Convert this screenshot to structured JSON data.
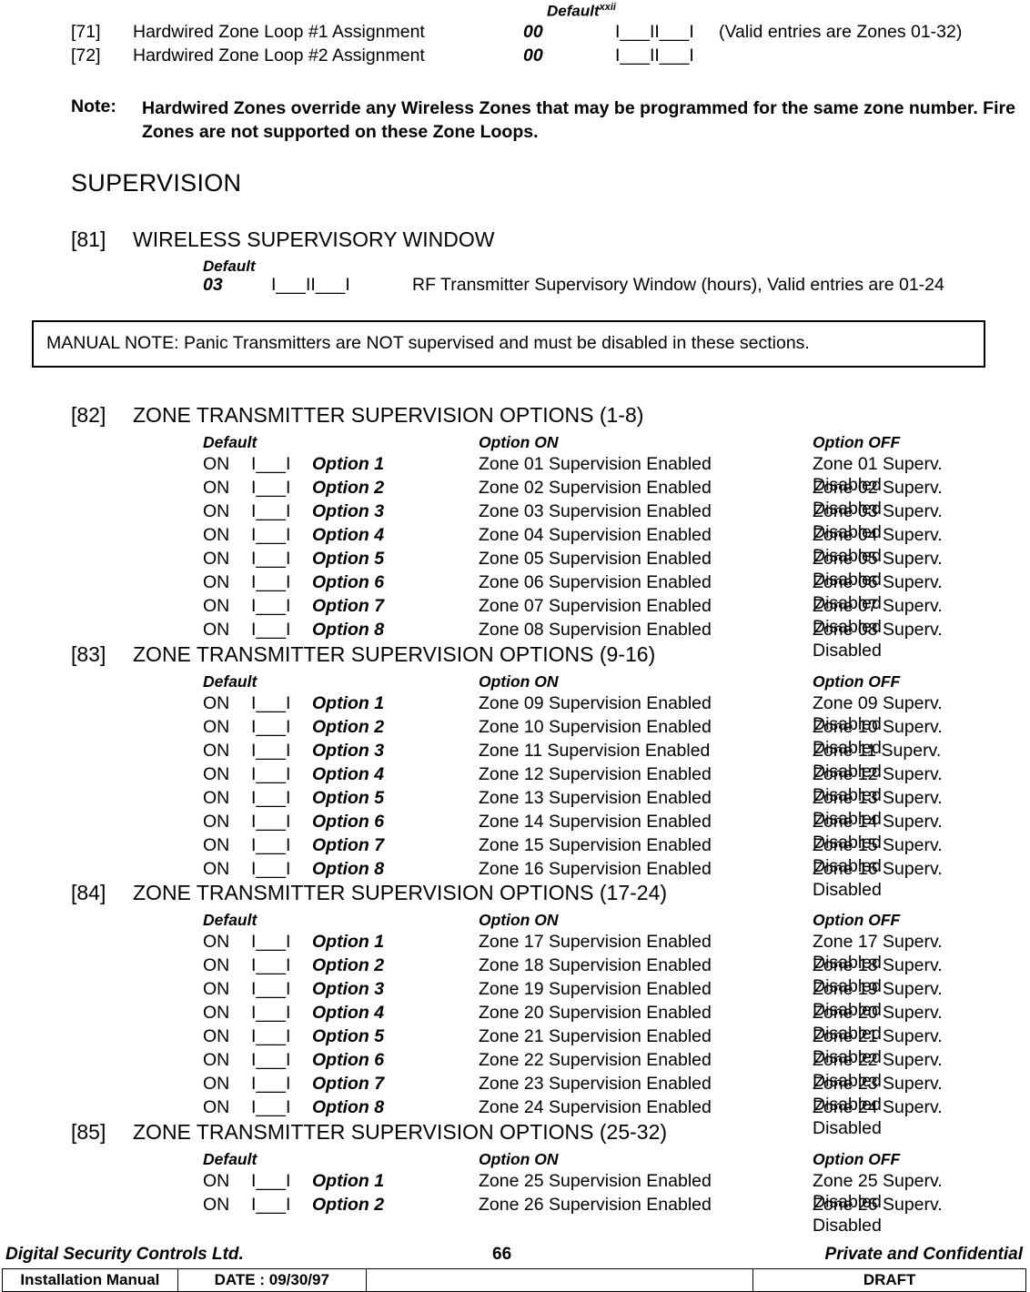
{
  "top": {
    "default_marker": "Default",
    "default_sup": "xxii",
    "loops": [
      {
        "num": "[71]",
        "desc": "Hardwired Zone Loop #1 Assignment",
        "default": "00",
        "blank": "I___II___I",
        "valid": "(Valid entries are Zones 01-32)"
      },
      {
        "num": "[72]",
        "desc": "Hardwired Zone Loop #2 Assignment",
        "default": "00",
        "blank": "I___II___I",
        "valid": ""
      }
    ],
    "note_label": "Note:",
    "note_body": "Hardwired Zones override any Wireless Zones that may be programmed for the same zone number. Fire Zones are not supported on these Zone Loops."
  },
  "section_title": "SUPERVISION",
  "sec81": {
    "num": "[81]",
    "title": "WIRELESS SUPERVISORY WINDOW",
    "default_label": "Default",
    "value": "03",
    "blank": "I___II___I",
    "desc": "RF Transmitter Supervisory Window (hours), Valid entries are 01-24"
  },
  "manual_note": "MANUAL NOTE:  Panic Transmitters are NOT supervised and must be disabled in these sections.",
  "columns": {
    "default": "Default",
    "option_on": "Option ON",
    "option_off": "Option OFF"
  },
  "sections": [
    {
      "num": "[82]",
      "title": "ZONE TRANSMITTER SUPERVISION OPTIONS (1-8)",
      "rows": [
        {
          "state": "ON",
          "blank": "I___I",
          "option": "Option 1",
          "on": "Zone 01 Supervision Enabled",
          "off": "Zone 01 Superv. Disabled"
        },
        {
          "state": "ON",
          "blank": "I___I",
          "option": "Option 2",
          "on": "Zone 02 Supervision Enabled",
          "off": "Zone 02 Superv. Disabled"
        },
        {
          "state": "ON",
          "blank": "I___I",
          "option": "Option 3",
          "on": "Zone 03 Supervision Enabled",
          "off": "Zone 03 Superv. Disabled"
        },
        {
          "state": "ON",
          "blank": "I___I",
          "option": "Option 4",
          "on": "Zone 04 Supervision Enabled",
          "off": "Zone 04 Superv. Disabled"
        },
        {
          "state": "ON",
          "blank": "I___I",
          "option": "Option 5",
          "on": "Zone 05 Supervision Enabled",
          "off": "Zone 05 Superv. Disabled"
        },
        {
          "state": "ON",
          "blank": "I___I",
          "option": "Option 6",
          "on": "Zone 06 Supervision Enabled",
          "off": "Zone 06 Superv. Disabled"
        },
        {
          "state": "ON",
          "blank": "I___I",
          "option": "Option 7",
          "on": "Zone 07 Supervision Enabled",
          "off": "Zone 07 Superv. Disabled"
        },
        {
          "state": "ON",
          "blank": "I___I",
          "option": "Option 8",
          "on": "Zone 08 Supervision Enabled",
          "off": "Zone 08 Superv. Disabled"
        }
      ]
    },
    {
      "num": "[83]",
      "title": "ZONE TRANSMITTER SUPERVISION OPTIONS (9-16)",
      "rows": [
        {
          "state": "ON",
          "blank": "I___I",
          "option": "Option 1",
          "on": "Zone 09 Supervision Enabled",
          "off": "Zone 09 Superv. Disabled"
        },
        {
          "state": "ON",
          "blank": "I___I",
          "option": "Option 2",
          "on": "Zone 10 Supervision Enabled",
          "off": "Zone 10 Superv. Disabled"
        },
        {
          "state": "ON",
          "blank": "I___I",
          "option": "Option 3",
          "on": "Zone 11 Supervision Enabled",
          "off": "Zone 11 Superv. Disabled"
        },
        {
          "state": "ON",
          "blank": "I___I",
          "option": "Option 4",
          "on": "Zone 12 Supervision Enabled",
          "off": "Zone 12 Superv. Disabled"
        },
        {
          "state": "ON",
          "blank": "I___I",
          "option": "Option 5",
          "on": "Zone 13 Supervision Enabled",
          "off": "Zone 13 Superv. Disabled"
        },
        {
          "state": "ON",
          "blank": "I___I",
          "option": "Option 6",
          "on": "Zone 14 Supervision Enabled",
          "off": "Zone 14 Superv. Disabled"
        },
        {
          "state": "ON",
          "blank": "I___I",
          "option": "Option 7",
          "on": "Zone 15 Supervision Enabled",
          "off": "Zone 15 Superv. Disabled"
        },
        {
          "state": "ON",
          "blank": "I___I",
          "option": "Option 8",
          "on": "Zone 16 Supervision Enabled",
          "off": "Zone 16 Superv. Disabled"
        }
      ]
    },
    {
      "num": "[84]",
      "title": "ZONE TRANSMITTER SUPERVISION OPTIONS (17-24)",
      "rows": [
        {
          "state": "ON",
          "blank": "I___I",
          "option": "Option 1",
          "on": "Zone 17 Supervision Enabled",
          "off": "Zone 17 Superv. Disabled"
        },
        {
          "state": "ON",
          "blank": "I___I",
          "option": "Option 2",
          "on": "Zone 18 Supervision Enabled",
          "off": "Zone 18 Superv. Disabled"
        },
        {
          "state": "ON",
          "blank": "I___I",
          "option": "Option 3",
          "on": "Zone 19 Supervision Enabled",
          "off": "Zone 19 Superv. Disabled"
        },
        {
          "state": "ON",
          "blank": "I___I",
          "option": "Option 4",
          "on": "Zone 20 Supervision Enabled",
          "off": "Zone 20 Superv. Disabled"
        },
        {
          "state": "ON",
          "blank": "I___I",
          "option": "Option 5",
          "on": "Zone 21 Supervision Enabled",
          "off": "Zone 21 Superv. Disabled"
        },
        {
          "state": "ON",
          "blank": "I___I",
          "option": "Option 6",
          "on": "Zone 22 Supervision Enabled",
          "off": "Zone 22 Superv. Disabled"
        },
        {
          "state": "ON",
          "blank": "I___I",
          "option": "Option 7",
          "on": "Zone 23 Supervision Enabled",
          "off": "Zone 23 Superv. Disabled"
        },
        {
          "state": "ON",
          "blank": "I___I",
          "option": "Option 8",
          "on": "Zone 24 Supervision Enabled",
          "off": "Zone 24 Superv. Disabled"
        }
      ]
    },
    {
      "num": "[85]",
      "title": "ZONE TRANSMITTER SUPERVISION OPTIONS (25-32)",
      "rows": [
        {
          "state": "ON",
          "blank": "I___I",
          "option": "Option 1",
          "on": "Zone 25 Supervision Enabled",
          "off": "Zone 25 Superv. Disabled"
        },
        {
          "state": "ON",
          "blank": "I___I",
          "option": "Option 2",
          "on": "Zone 26 Supervision Enabled",
          "off": "Zone 26 Superv. Disabled"
        }
      ]
    }
  ],
  "footer": {
    "company": "Digital Security Controls Ltd.",
    "page": "66",
    "confidential": "Private and Confidential",
    "manual": "Installation Manual",
    "date": "DATE :  09/30/97",
    "middle": "",
    "status": "DRAFT"
  }
}
